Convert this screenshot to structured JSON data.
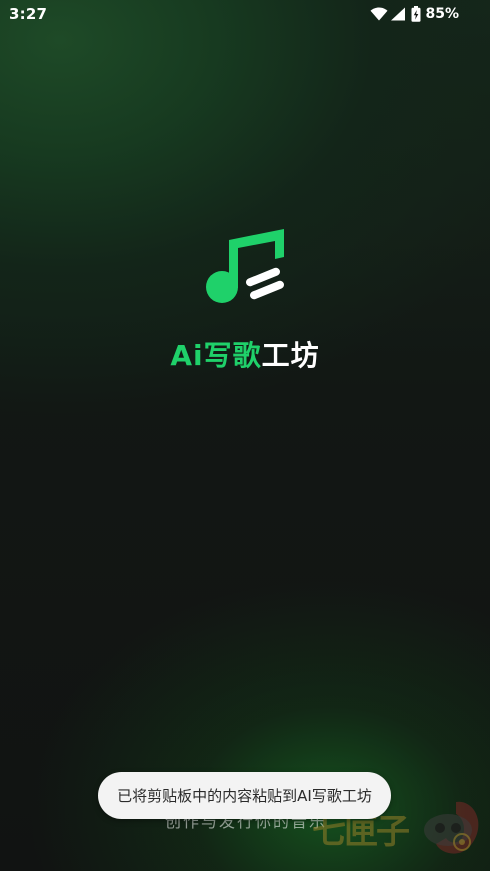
{
  "status_bar": {
    "time": "3:27",
    "battery_percent": "85%",
    "icons": [
      "wifi-icon",
      "cell-signal-icon",
      "battery-charging-icon"
    ]
  },
  "app": {
    "title_accent": "Ai写歌",
    "title_rest": "工坊",
    "logo_icon": "music-note-icon",
    "tagline": "创作与发行你的音乐"
  },
  "toast": {
    "message": "已将剪贴板中的内容粘贴到AI写歌工坊"
  },
  "watermark": {
    "text": "七匣子"
  },
  "colors": {
    "accent": "#1fd16a",
    "background": "#111312",
    "toast_bg": "#f3f3f3"
  }
}
